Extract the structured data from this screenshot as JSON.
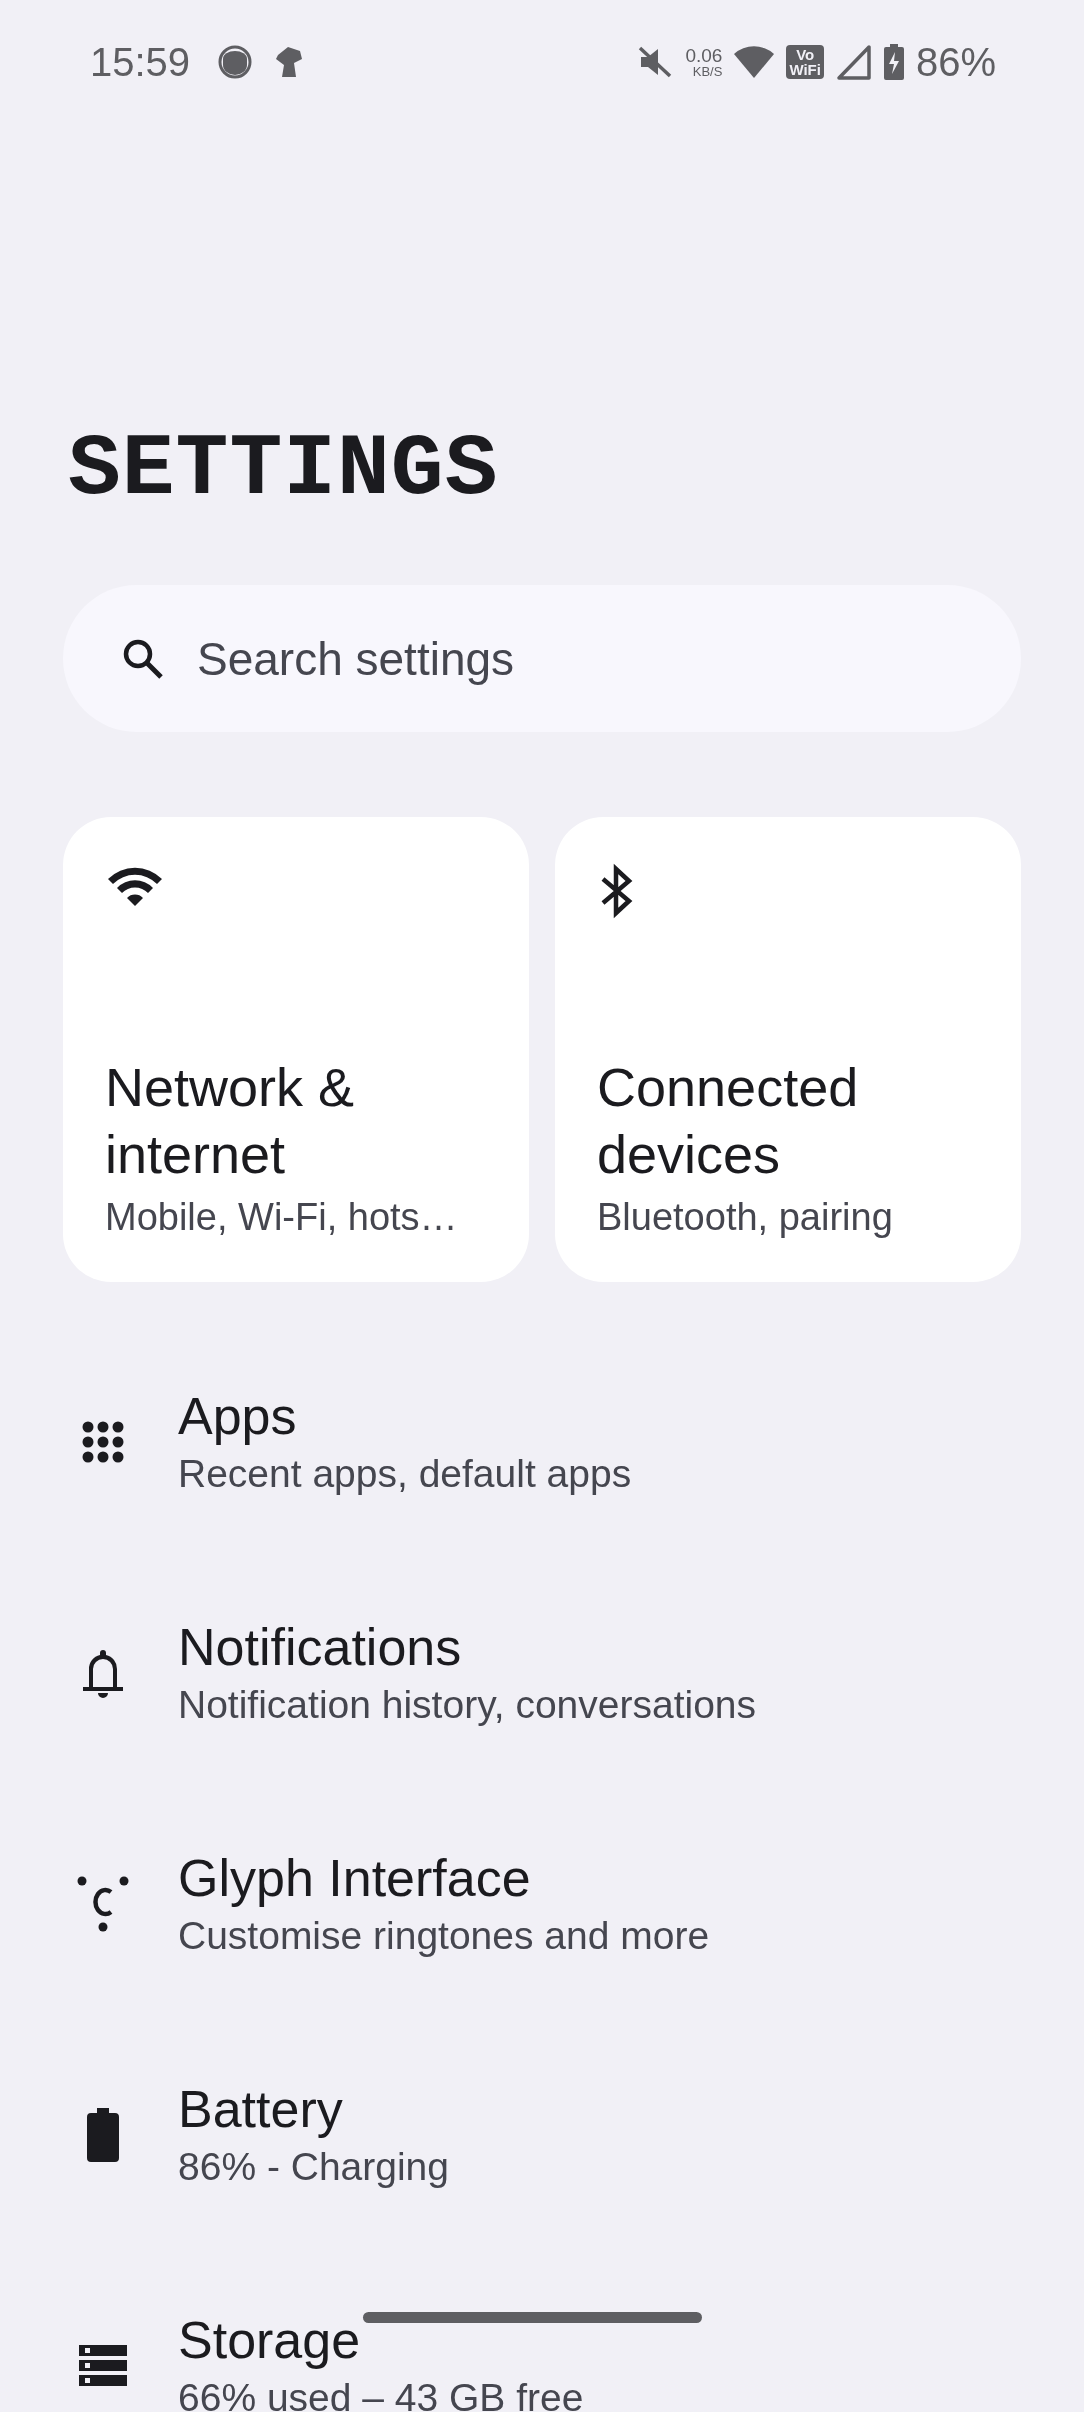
{
  "status_bar": {
    "time": "15:59",
    "speed_value": "0.06",
    "speed_unit": "KB/S",
    "vowifi_top": "Vo",
    "vowifi_bottom": "WiFi",
    "battery": "86%"
  },
  "title": "SETTINGS",
  "search": {
    "placeholder": "Search settings"
  },
  "cards": [
    {
      "kind": "wifi",
      "title": "Network & internet",
      "subtitle": "Mobile, Wi-Fi, hots…"
    },
    {
      "kind": "bluetooth",
      "title": "Connected devices",
      "subtitle": "Bluetooth, pairing"
    }
  ],
  "items": [
    {
      "kind": "apps",
      "title": "Apps",
      "subtitle": "Recent apps, default apps"
    },
    {
      "kind": "bell",
      "title": "Notifications",
      "subtitle": "Notification history, conversations"
    },
    {
      "kind": "glyph",
      "title": "Glyph Interface",
      "subtitle": "Customise ringtones and more"
    },
    {
      "kind": "battery",
      "title": "Battery",
      "subtitle": "86% - Charging"
    },
    {
      "kind": "storage",
      "title": "Storage",
      "subtitle": "66% used – 43 GB free"
    }
  ]
}
